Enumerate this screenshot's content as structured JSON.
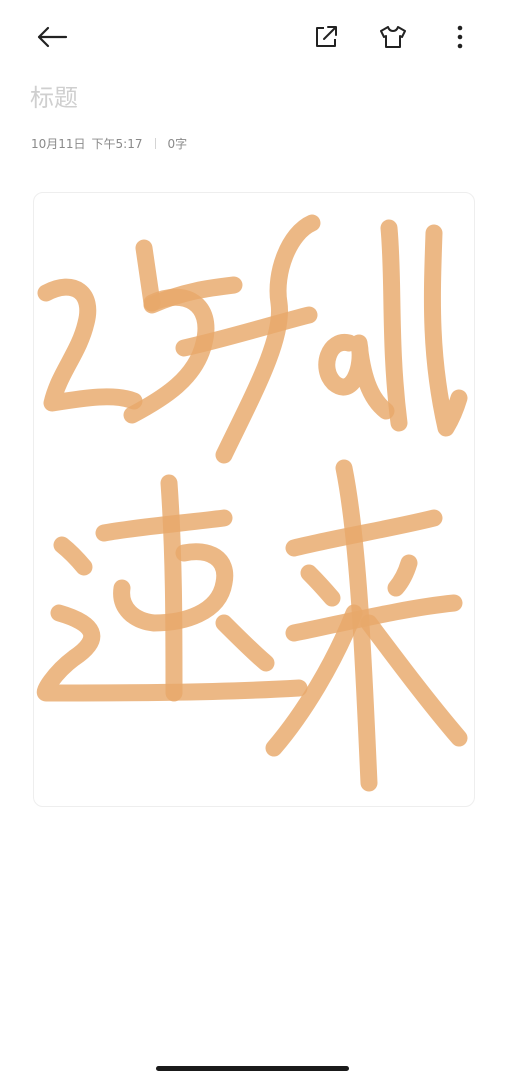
{
  "toolbar": {
    "back_icon": "arrow-left-icon",
    "share_icon": "share-external-icon",
    "theme_icon": "tshirt-icon",
    "more_icon": "more-vertical-icon"
  },
  "note": {
    "title_placeholder": "标题",
    "title_value": "",
    "date": "10月11日",
    "time": "下午5:17",
    "word_count": "0字"
  },
  "drawing": {
    "stroke_color": "#e8a86a",
    "description_text_line1": "25fall",
    "description_text_line2": "速来"
  }
}
